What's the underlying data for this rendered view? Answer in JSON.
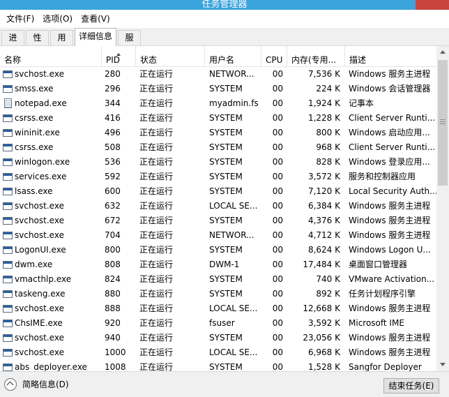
{
  "window": {
    "title": "任务管理器"
  },
  "menu": [
    "文件(F)",
    "选项(O)",
    "查看(V)"
  ],
  "tabs": [
    {
      "label": "进程",
      "active": false
    },
    {
      "label": "性能",
      "active": false
    },
    {
      "label": "用户",
      "active": false
    },
    {
      "label": "详细信息",
      "active": true
    },
    {
      "label": "服务",
      "active": false
    }
  ],
  "columns": {
    "name": "名称",
    "pid": "PID",
    "status": "状态",
    "user": "用户名",
    "cpu": "CPU",
    "mem": "内存(专用...",
    "desc": "描述"
  },
  "rows": [
    {
      "name": "svchost.exe",
      "pid": "280",
      "status": "正在运行",
      "user": "NETWOR...",
      "cpu": "00",
      "mem": "7,536 K",
      "desc": "Windows 服务主进程"
    },
    {
      "name": "smss.exe",
      "pid": "296",
      "status": "正在运行",
      "user": "SYSTEM",
      "cpu": "00",
      "mem": "224 K",
      "desc": "Windows 会话管理器"
    },
    {
      "name": "notepad.exe",
      "pid": "344",
      "status": "正在运行",
      "user": "myadmin.fs",
      "cpu": "00",
      "mem": "1,924 K",
      "desc": "记事本"
    },
    {
      "name": "csrss.exe",
      "pid": "416",
      "status": "正在运行",
      "user": "SYSTEM",
      "cpu": "00",
      "mem": "1,228 K",
      "desc": "Client Server Runti..."
    },
    {
      "name": "wininit.exe",
      "pid": "496",
      "status": "正在运行",
      "user": "SYSTEM",
      "cpu": "00",
      "mem": "800 K",
      "desc": "Windows 启动应用..."
    },
    {
      "name": "csrss.exe",
      "pid": "508",
      "status": "正在运行",
      "user": "SYSTEM",
      "cpu": "00",
      "mem": "968 K",
      "desc": "Client Server Runti..."
    },
    {
      "name": "winlogon.exe",
      "pid": "536",
      "status": "正在运行",
      "user": "SYSTEM",
      "cpu": "00",
      "mem": "828 K",
      "desc": "Windows 登录应用..."
    },
    {
      "name": "services.exe",
      "pid": "592",
      "status": "正在运行",
      "user": "SYSTEM",
      "cpu": "00",
      "mem": "3,572 K",
      "desc": "服务和控制器应用"
    },
    {
      "name": "lsass.exe",
      "pid": "600",
      "status": "正在运行",
      "user": "SYSTEM",
      "cpu": "00",
      "mem": "7,120 K",
      "desc": "Local Security Auth..."
    },
    {
      "name": "svchost.exe",
      "pid": "632",
      "status": "正在运行",
      "user": "LOCAL SE...",
      "cpu": "00",
      "mem": "6,384 K",
      "desc": "Windows 服务主进程"
    },
    {
      "name": "svchost.exe",
      "pid": "672",
      "status": "正在运行",
      "user": "SYSTEM",
      "cpu": "00",
      "mem": "4,376 K",
      "desc": "Windows 服务主进程"
    },
    {
      "name": "svchost.exe",
      "pid": "704",
      "status": "正在运行",
      "user": "NETWOR...",
      "cpu": "00",
      "mem": "4,712 K",
      "desc": "Windows 服务主进程"
    },
    {
      "name": "LogonUI.exe",
      "pid": "800",
      "status": "正在运行",
      "user": "SYSTEM",
      "cpu": "00",
      "mem": "8,624 K",
      "desc": "Windows Logon U..."
    },
    {
      "name": "dwm.exe",
      "pid": "808",
      "status": "正在运行",
      "user": "DWM-1",
      "cpu": "00",
      "mem": "17,484 K",
      "desc": "桌面窗口管理器"
    },
    {
      "name": "vmacthlp.exe",
      "pid": "824",
      "status": "正在运行",
      "user": "SYSTEM",
      "cpu": "00",
      "mem": "740 K",
      "desc": "VMware Activation..."
    },
    {
      "name": "taskeng.exe",
      "pid": "880",
      "status": "正在运行",
      "user": "SYSTEM",
      "cpu": "00",
      "mem": "892 K",
      "desc": "任务计划程序引擎"
    },
    {
      "name": "svchost.exe",
      "pid": "888",
      "status": "正在运行",
      "user": "LOCAL SE...",
      "cpu": "00",
      "mem": "12,668 K",
      "desc": "Windows 服务主进程"
    },
    {
      "name": "ChsIME.exe",
      "pid": "920",
      "status": "正在运行",
      "user": "fsuser",
      "cpu": "00",
      "mem": "3,592 K",
      "desc": "Microsoft IME"
    },
    {
      "name": "svchost.exe",
      "pid": "940",
      "status": "正在运行",
      "user": "SYSTEM",
      "cpu": "00",
      "mem": "23,056 K",
      "desc": "Windows 服务主进程"
    },
    {
      "name": "svchost.exe",
      "pid": "1000",
      "status": "正在运行",
      "user": "LOCAL SE...",
      "cpu": "00",
      "mem": "6,968 K",
      "desc": "Windows 服务主进程"
    },
    {
      "name": "abs_deployer.exe",
      "pid": "1008",
      "status": "正在运行",
      "user": "SYSTEM",
      "cpu": "00",
      "mem": "1,528 K",
      "desc": "Sangfor Deployer"
    }
  ],
  "footer": {
    "fewer_details": "简略信息(D)",
    "end_task": "结束任务(E)"
  }
}
